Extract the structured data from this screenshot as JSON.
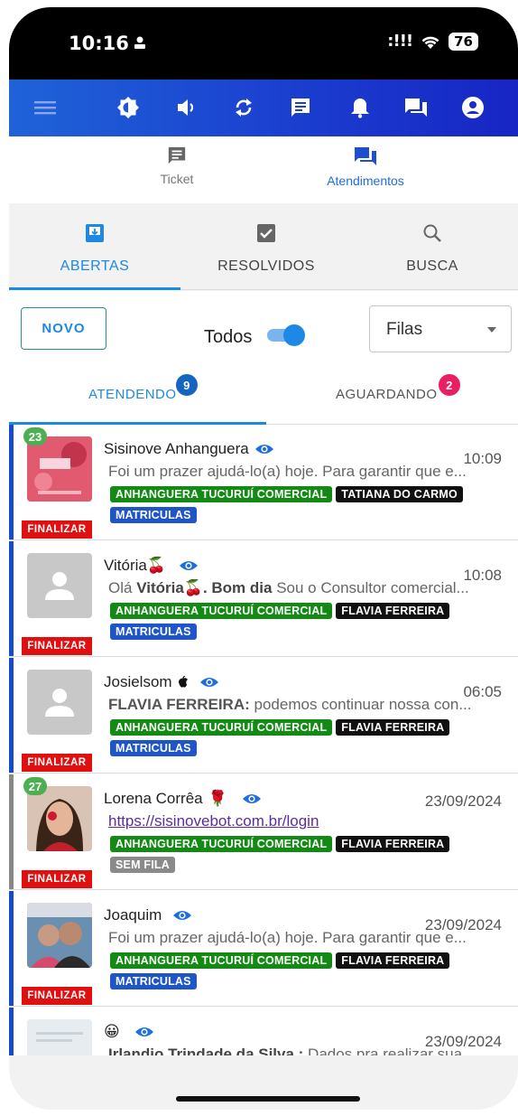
{
  "status_bar": {
    "time": "10:16",
    "signal": ":!!!",
    "battery": "76"
  },
  "top_tabs": [
    {
      "label": "Ticket",
      "icon": "message-icon",
      "active": false
    },
    {
      "label": "Atendimentos",
      "icon": "forum-icon",
      "active": true
    }
  ],
  "sub_tabs": [
    {
      "label": "ABERTAS",
      "icon": "inbox-icon",
      "active": true
    },
    {
      "label": "RESOLVIDOS",
      "icon": "check-box-icon",
      "active": false
    },
    {
      "label": "BUSCA",
      "icon": "search-icon",
      "active": false
    }
  ],
  "filters": {
    "novo_label": "NOVO",
    "todos_label": "Todos",
    "todos_on": true,
    "filas_label": "Filas"
  },
  "status_tabs": [
    {
      "label": "ATENDENDO",
      "badge": "9",
      "badge_color": "#1565c0",
      "active": true
    },
    {
      "label": "AGUARDANDO",
      "badge": "2",
      "badge_color": "#e91e63",
      "active": false
    }
  ],
  "finalizar_label": "FINALIZAR",
  "tickets": [
    {
      "name": "Sisinove Anhanguera",
      "emoji": "",
      "time": "10:09",
      "count": "23",
      "message_prefix": "",
      "message_bold": "",
      "message": "Foi um prazer ajudá-lo(a) hoje. Para garantir que e...",
      "tags": [
        "ANHANGUERA TUCURUÍ COMERCIAL",
        "TATIANA DO CARMO"
      ],
      "queue": "MATRICULAS",
      "avatar": "outubro-rosa"
    },
    {
      "name": "Vitória",
      "emoji": "🍒",
      "time": "10:08",
      "count": "",
      "message_prefix": "Olá ",
      "message_bold": "Vitória🍒. Bom dia",
      "message": " Sou o Consultor comercial...",
      "tags": [
        "ANHANGUERA TUCURUÍ COMERCIAL",
        "FLAVIA FERREIRA"
      ],
      "queue": "MATRICULAS",
      "avatar": "placeholder"
    },
    {
      "name": "Josielsom",
      "emoji": "",
      "time": "06:05",
      "count": "",
      "message_prefix": "",
      "message_bold": "FLAVIA FERREIRA:",
      "message": " podemos continuar nossa con...",
      "tags": [
        "ANHANGUERA TUCURUÍ COMERCIAL",
        "FLAVIA FERREIRA"
      ],
      "queue": "MATRICULAS",
      "avatar": "placeholder"
    },
    {
      "name": "Lorena Corrêa",
      "emoji": "🌹",
      "time": "23/09/2024",
      "count": "27",
      "message_prefix": "",
      "message_bold": "",
      "message": "https://sisinovebot.com.br/login",
      "tags": [
        "ANHANGUERA TUCURUÍ COMERCIAL",
        "FLAVIA FERREIRA"
      ],
      "queue": "SEM FILA",
      "avatar": "photo-woman"
    },
    {
      "name": "Joaquim",
      "emoji": "",
      "time": "23/09/2024",
      "count": "",
      "message_prefix": "",
      "message_bold": "",
      "message": "Foi um prazer ajudá-lo(a) hoje. Para garantir que e...",
      "tags": [
        "ANHANGUERA TUCURUÍ COMERCIAL",
        "FLAVIA FERREIRA"
      ],
      "queue": "MATRICULAS",
      "avatar": "photo-couple"
    },
    {
      "name": "😀",
      "emoji": "",
      "time": "23/09/2024",
      "count": "",
      "message_prefix": "",
      "message_bold": "Irlandio Trindade da Silva :",
      "message": " Dados pra realizar sua...",
      "tags": [],
      "queue": "",
      "avatar": "document"
    }
  ]
}
